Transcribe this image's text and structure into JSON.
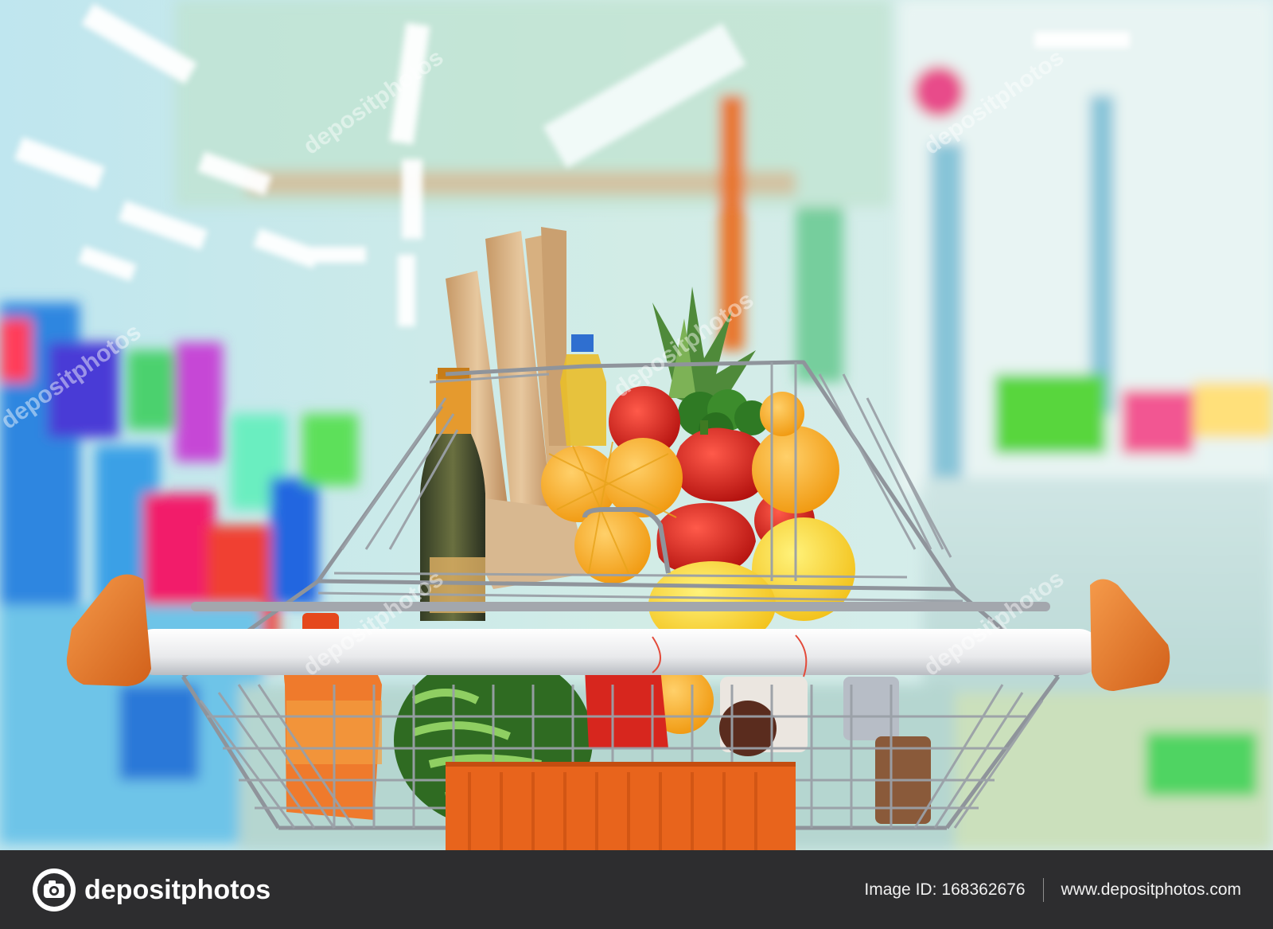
{
  "photo": {
    "alt": "",
    "watermark_text": "depositphotos"
  },
  "footer": {
    "brand_name": "depositphotos",
    "image_id_label": "Image ID:",
    "image_id_value": "168362676",
    "site_url": "www.depositphotos.com"
  },
  "icons": {
    "brand_logo": "camera-icon"
  },
  "colors": {
    "footer_background": "#2d2d2f",
    "cart_handle": "#e07020",
    "cart_basket": "#e8641c"
  }
}
